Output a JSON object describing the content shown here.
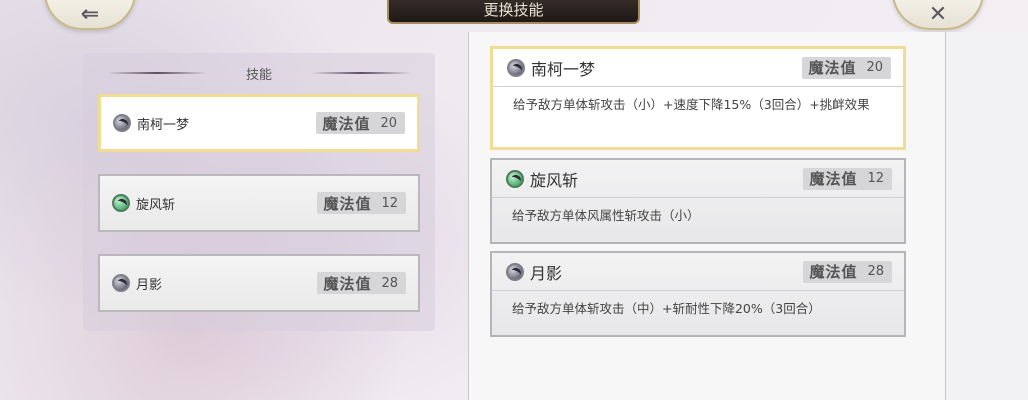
{
  "header": {
    "title": "更换技能",
    "back_icon": "arrow-left-icon",
    "close_icon": "close-icon"
  },
  "left_panel": {
    "title": "技能",
    "skills": [
      {
        "name": "南柯一梦",
        "mp_label": "魔法值",
        "mp": "20",
        "selected": true
      },
      {
        "name": "旋风斩",
        "mp_label": "魔法值",
        "mp": "12",
        "selected": false
      },
      {
        "name": "月影",
        "mp_label": "魔法值",
        "mp": "28",
        "selected": false
      }
    ]
  },
  "right_panel": {
    "skills": [
      {
        "name": "南柯一梦",
        "mp_label": "魔法值",
        "mp": "20",
        "desc": "给予敌方单体斩攻击（小）+速度下降15%（3回合）+挑衅效果",
        "selected": true
      },
      {
        "name": "旋风斩",
        "mp_label": "魔法值",
        "mp": "12",
        "desc": "给予敌方单体风属性斩攻击（小）",
        "selected": false
      },
      {
        "name": "月影",
        "mp_label": "魔法值",
        "mp": "28",
        "desc": "给予敌方单体斩攻击（中）+斩耐性下降20%（3回合）",
        "selected": false
      }
    ]
  },
  "colors": {
    "highlight_border": "#f2dc93",
    "title_bg": "#2a221e"
  }
}
